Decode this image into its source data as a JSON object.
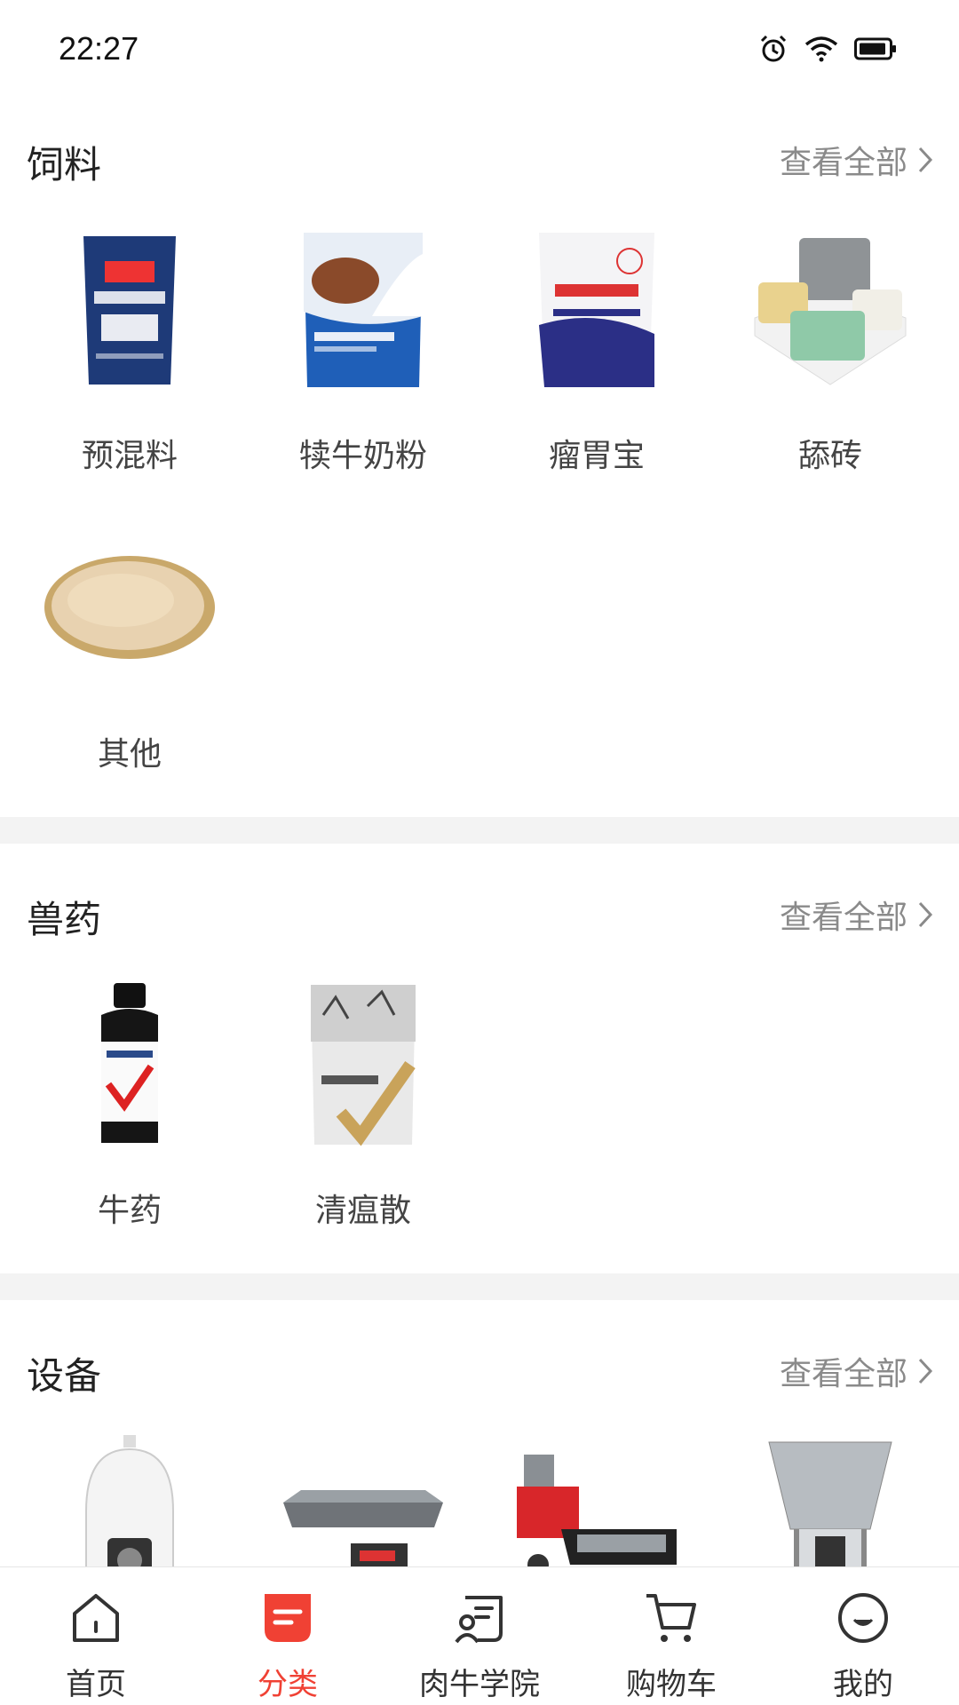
{
  "status_bar": {
    "time": "22:27",
    "icons": [
      "alarm-icon",
      "wifi-icon",
      "battery-icon"
    ]
  },
  "sections": [
    {
      "title": "饲料",
      "view_all": "查看全部",
      "items": [
        {
          "label": "预混料",
          "icon": "premix-bag-image"
        },
        {
          "label": "犊牛奶粉",
          "icon": "calf-milk-powder-image"
        },
        {
          "label": "瘤胃宝",
          "icon": "rumen-product-image"
        },
        {
          "label": "舔砖",
          "icon": "lick-block-image"
        },
        {
          "label": "其他",
          "icon": "grain-basket-image"
        }
      ]
    },
    {
      "title": "兽药",
      "view_all": "查看全部",
      "items": [
        {
          "label": "牛药",
          "icon": "medicine-bottle-image"
        },
        {
          "label": "清瘟散",
          "icon": "herbal-pack-image"
        }
      ]
    },
    {
      "title": "设备",
      "view_all": "查看全部",
      "items": [
        {
          "icon": "security-camera-image"
        },
        {
          "icon": "platform-scale-image"
        },
        {
          "icon": "chaff-cutter-image"
        },
        {
          "icon": "feed-mixer-image"
        }
      ]
    }
  ],
  "tabbar": {
    "items": [
      {
        "label": "首页",
        "icon": "home-icon",
        "active": false
      },
      {
        "label": "分类",
        "icon": "category-icon",
        "active": true
      },
      {
        "label": "肉牛学院",
        "icon": "academy-icon",
        "active": false
      },
      {
        "label": "购物车",
        "icon": "cart-icon",
        "active": false
      },
      {
        "label": "我的",
        "icon": "profile-icon",
        "active": false
      }
    ],
    "active_color": "#f04134"
  }
}
